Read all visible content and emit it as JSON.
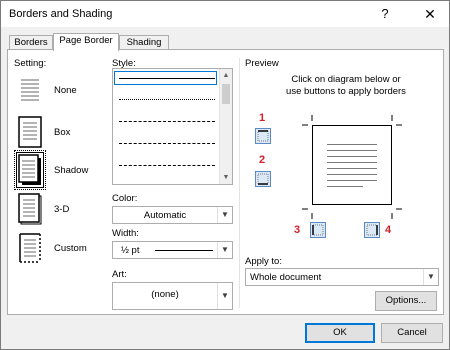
{
  "window": {
    "title": "Borders and Shading",
    "help": "?",
    "close": "✕"
  },
  "tabs": [
    {
      "label": "Borders"
    },
    {
      "label": "Page Border"
    },
    {
      "label": "Shading"
    }
  ],
  "setting": {
    "label": "Setting:",
    "items": [
      {
        "label": "None"
      },
      {
        "label": "Box"
      },
      {
        "label": "Shadow"
      },
      {
        "label": "3-D"
      },
      {
        "label": "Custom"
      }
    ],
    "selected": "Shadow"
  },
  "style": {
    "label": "Style:"
  },
  "color": {
    "label": "Color:",
    "value": "Automatic"
  },
  "width": {
    "label": "Width:",
    "value": "½ pt"
  },
  "art": {
    "label": "Art:",
    "value": "(none)"
  },
  "preview": {
    "label": "Preview",
    "hint_line1": "Click on diagram below or",
    "hint_line2": "use buttons to apply borders",
    "markers": [
      "1",
      "2",
      "3",
      "4"
    ]
  },
  "apply_to": {
    "label": "Apply to:",
    "value": "Whole document"
  },
  "buttons": {
    "options": "Options...",
    "ok": "OK",
    "cancel": "Cancel"
  },
  "colors": {
    "accent": "#0078d7",
    "marker": "#d0202a"
  }
}
